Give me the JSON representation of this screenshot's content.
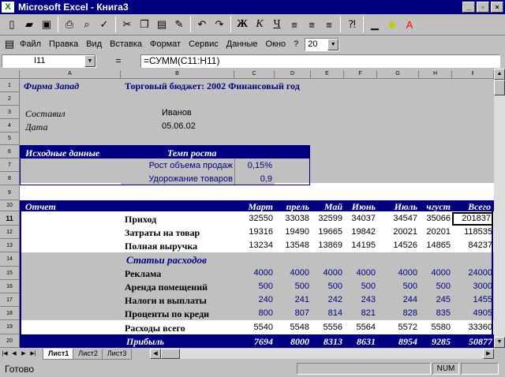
{
  "window": {
    "title": "Microsoft Excel - Книга3",
    "app_icon": "excel-icon"
  },
  "toolbar": {
    "font_bold": "Ж",
    "font_italic": "К",
    "font_underline": "Ч"
  },
  "menu": {
    "items": [
      "Файл",
      "Правка",
      "Вид",
      "Вставка",
      "Формат",
      "Сервис",
      "Данные",
      "Окно",
      "?"
    ],
    "zoom": "20"
  },
  "formula_bar": {
    "cell_ref": "I11",
    "eq": "=",
    "formula": "=СУММ(C11:H11)"
  },
  "columns": [
    "A",
    "B",
    "C",
    "D",
    "E",
    "F",
    "G",
    "H",
    "I"
  ],
  "rows": [
    "1",
    "2",
    "3",
    "4",
    "5",
    "6",
    "7",
    "8",
    "9",
    "10",
    "11",
    "12",
    "13",
    "14",
    "15",
    "16",
    "17",
    "18",
    "19",
    "20"
  ],
  "sheet": {
    "company": "Фирма Запад",
    "title": "Торговый бюджет: 2002 Финансовый год",
    "compiled_label": "Составил",
    "compiled_value": "Иванов",
    "date_label": "Дата",
    "date_value": "05.06.02",
    "inputs_header": "Исходные данные",
    "growth_header": "Темп роста",
    "sales_growth_label": "Рост объема продаж",
    "sales_growth_value": "0,15%",
    "cost_growth_label": "Удорожание товаров",
    "cost_growth_value": "0,9",
    "report_label": "Отчет",
    "months": [
      "Март",
      "прель",
      "Май",
      "Июнь",
      "Июль",
      "чгуст",
      "Всего"
    ],
    "income_label": "Приход",
    "income": [
      "32550",
      "33038",
      "32599",
      "34037",
      "34547",
      "35066",
      "201837"
    ],
    "costs_label": "Затраты на товар",
    "costs": [
      "19316",
      "19490",
      "19665",
      "19842",
      "20021",
      "20201",
      "118535"
    ],
    "revenue_label": "Полная выручка",
    "revenue": [
      "13234",
      "13548",
      "13869",
      "14195",
      "14526",
      "14865",
      "84237"
    ],
    "expenses_header": "Статьи расходов",
    "ads_label": "Реклама",
    "ads": [
      "4000",
      "4000",
      "4000",
      "4000",
      "4000",
      "4000",
      "24000"
    ],
    "rent_label": "Аренда помещений",
    "rent": [
      "500",
      "500",
      "500",
      "500",
      "500",
      "500",
      "3000"
    ],
    "taxes_label": "Налоги и выплаты",
    "taxes": [
      "240",
      "241",
      "242",
      "243",
      "244",
      "245",
      "1455"
    ],
    "interest_label": "Проценты по креди",
    "interest": [
      "800",
      "807",
      "814",
      "821",
      "828",
      "835",
      "4905"
    ],
    "total_exp_label": "Расходы всего",
    "total_exp": [
      "5540",
      "5548",
      "5556",
      "5564",
      "5572",
      "5580",
      "33360"
    ],
    "profit_label": "Прибыль",
    "profit": [
      "7694",
      "8000",
      "8313",
      "8631",
      "8954",
      "9285",
      "50877"
    ]
  },
  "tabs": [
    "Лист1",
    "Лист2",
    "Лист3"
  ],
  "status": {
    "text": "Готово",
    "num": "NUM"
  }
}
